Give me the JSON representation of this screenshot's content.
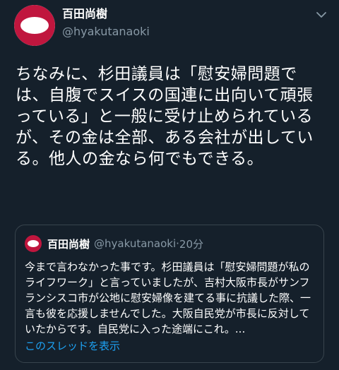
{
  "tweet": {
    "author_name": "百田尚樹",
    "author_handle": "@hyakutanaoki",
    "text": "ちなみに、杉田議員は「慰安婦問題では、自腹でスイスの国連に出向いて頑張っている」と一般に受け止められているが、その金は全部、ある会社が出している。他人の金なら何でもできる。"
  },
  "quoted": {
    "author_name": "百田尚樹",
    "author_handle": "@hyakutanaoki",
    "separator": "·",
    "time": "20分",
    "text": "今まで言わなかった事です。杉田議員は「慰安婦問題が私のライフワーク」と言っていましたが、吉村大阪市長がサンフランシスコ市が公地に慰安婦像を建てる事に抗議した際、一言も彼を応援しませんでした。大阪自民党が市長に反対していたからです。自民党に入った途端にこれ。...",
    "show_thread": "このスレッドを表示"
  },
  "colors": {
    "background": "#15202b",
    "accent": "#1da1f2",
    "secondary_text": "#8899a6",
    "avatar_red": "#c0163e"
  },
  "icons": {
    "menu": "chevron-down-icon"
  }
}
